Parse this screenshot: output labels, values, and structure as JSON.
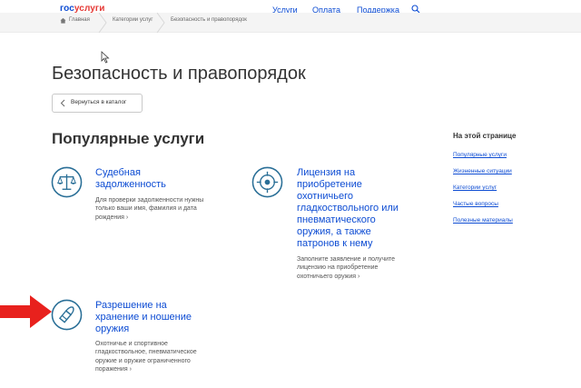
{
  "header": {
    "logo_gos": "гос",
    "logo_uslugi": "услуги",
    "nav": [
      "Услуги",
      "Оплата",
      "Поддержка"
    ],
    "search_icon": "search-icon"
  },
  "breadcrumb": {
    "items": [
      "Главная",
      "Категории услуг",
      "Безопасность и правопорядок"
    ]
  },
  "main": {
    "title": "Безопасность и правопорядок",
    "back_button": "Вернуться в каталог",
    "section_title": "Популярные услуги",
    "services": [
      {
        "title": "Судебная задолженность",
        "desc": "Для проверки задолженности нужны только ваши имя, фамилия и дата рождения",
        "icon": "scales-icon"
      },
      {
        "title": "Лицензия на приобретение охотничьего гладкоствольного или пневматического оружия, а также патронов к нему",
        "desc": "Заполните заявление и получите лицензию на приобретение охотничьего оружия",
        "icon": "target-icon"
      },
      {
        "title": "Разрешение на хранение и ношение оружия",
        "desc": "Охотничье и спортивное гладкоствольное, пневматическое оружие и оружие ограниченного поражения",
        "icon": "bullet-icon"
      }
    ],
    "more_glyph": "›"
  },
  "aside": {
    "title": "На этой странице",
    "links": [
      "Популярные услуги",
      "Жизненные ситуации",
      "Категории услуг",
      "Частые вопросы",
      "Полезные материалы"
    ]
  },
  "colors": {
    "accent": "#0d4cd3",
    "icon_teal": "#2a6f97",
    "arrow_red": "#e8211d"
  }
}
